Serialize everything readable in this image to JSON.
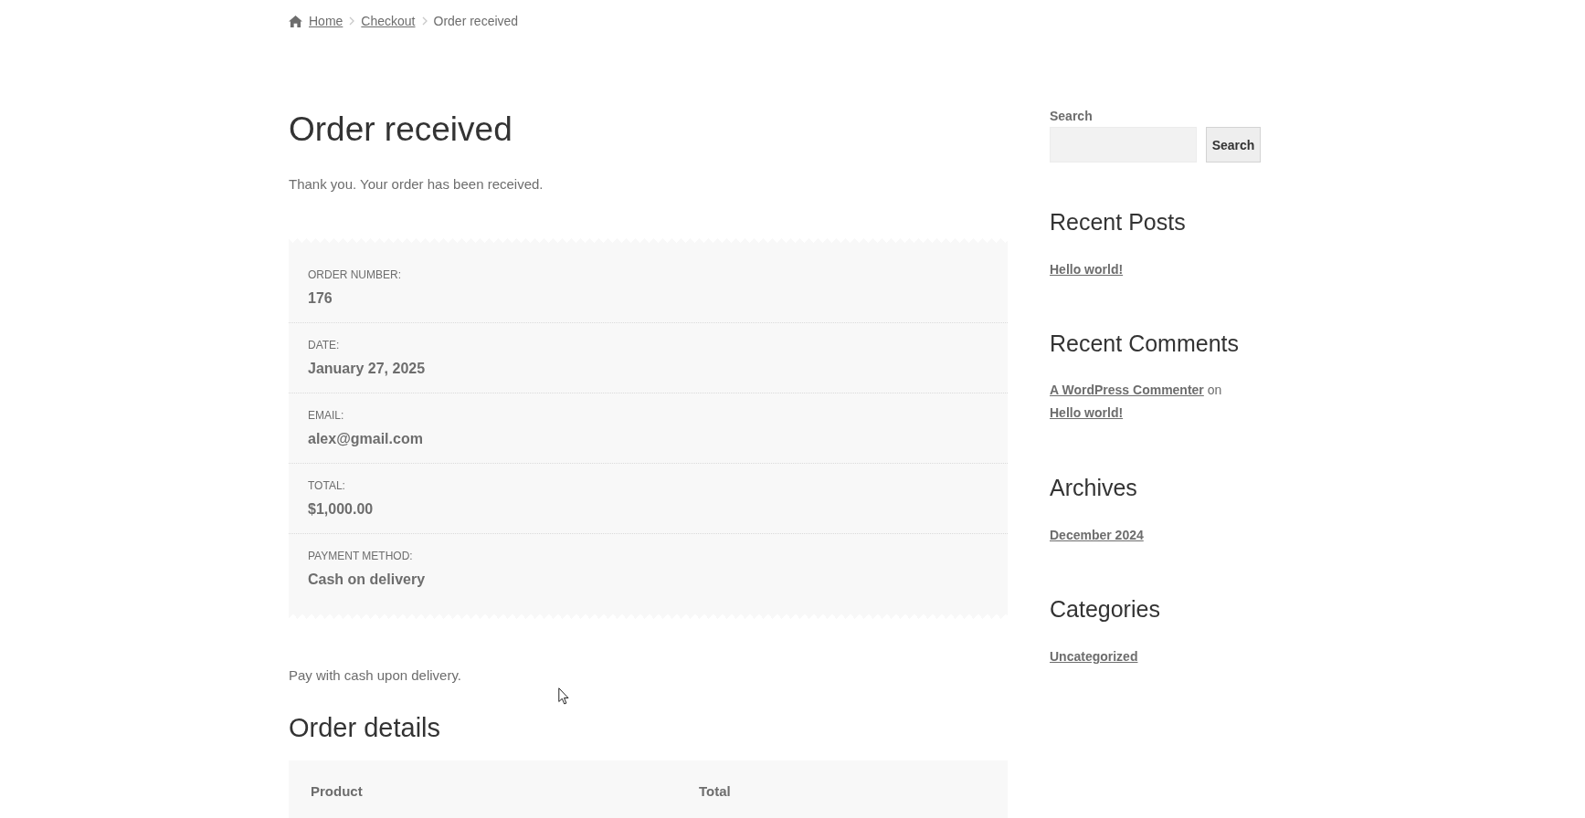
{
  "breadcrumb": [
    {
      "kind": "link",
      "label": "Home"
    },
    {
      "kind": "link",
      "label": "Checkout"
    },
    {
      "kind": "current",
      "label": "Order received"
    }
  ],
  "page_title": "Order received",
  "notice": "Thank you. Your order has been received.",
  "order_overview": [
    {
      "label": "ORDER NUMBER:",
      "value": "176"
    },
    {
      "label": "DATE:",
      "value": "January 27, 2025"
    },
    {
      "label": "EMAIL:",
      "value": "alex@gmail.com"
    },
    {
      "label": "TOTAL:",
      "value": "$1,000.00"
    },
    {
      "label": "PAYMENT METHOD:",
      "value": "Cash on delivery"
    }
  ],
  "payment_instructions": "Pay with cash upon delivery.",
  "order_details": {
    "title": "Order details",
    "table": {
      "columns": [
        "Product",
        "Total"
      ]
    }
  },
  "sidebar": {
    "search": {
      "label": "Search",
      "button": "Search"
    },
    "widgets": [
      {
        "kind": "links",
        "title": "Recent Posts",
        "items": [
          "Hello world!"
        ]
      },
      {
        "kind": "comments",
        "title": "Recent Comments",
        "items": [
          {
            "author": "A WordPress Commenter",
            "connector": "on",
            "post": "Hello world!"
          }
        ]
      },
      {
        "kind": "links",
        "title": "Archives",
        "items": [
          "December 2024"
        ]
      },
      {
        "kind": "links",
        "title": "Categories",
        "items": [
          "Uncategorized"
        ]
      }
    ]
  }
}
